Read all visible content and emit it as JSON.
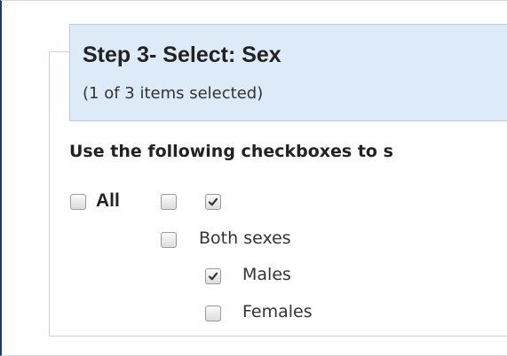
{
  "step": {
    "title": "Step 3- Select: Sex",
    "subtitle": "(1 of 3 items selected)"
  },
  "instruction": "Use the following checkboxes to s",
  "checkboxes": {
    "all": {
      "label": "All",
      "checked": false
    },
    "col_unchecked": {
      "checked": false
    },
    "col_checked": {
      "checked": true
    },
    "both_sexes": {
      "label": "Both sexes",
      "checked": false
    },
    "males": {
      "label": "Males",
      "checked": true
    },
    "females": {
      "label": "Females",
      "checked": false
    }
  },
  "colors": {
    "header_bg": "#ddeaf8",
    "header_border": "#b9cce4",
    "check_mark": "#333333"
  },
  "icons": {
    "checked": "checkmark-icon"
  }
}
